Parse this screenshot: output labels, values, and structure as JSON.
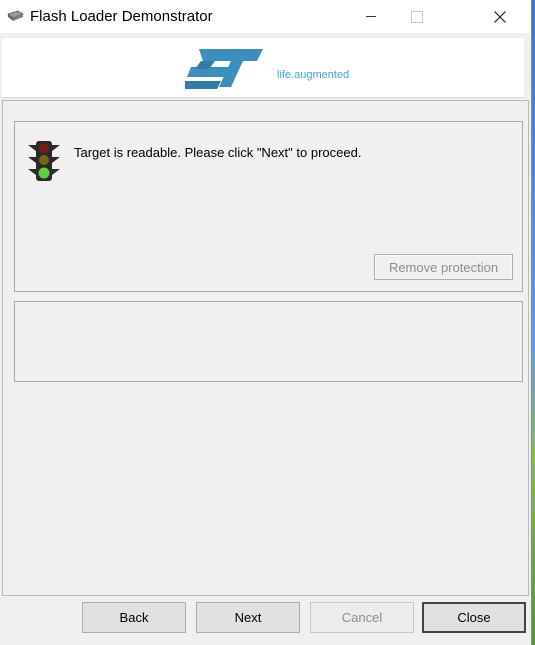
{
  "window": {
    "title": "Flash Loader Demonstrator",
    "app_icon": "chip-icon",
    "controls": {
      "minimize": "minimize-icon",
      "maximize": "maximize-icon",
      "close": "close-icon"
    }
  },
  "header": {
    "logo": "st-logo",
    "tagline": "life.augmented",
    "colors": {
      "logo_blue": "#3a8fbf",
      "tagline": "#39a9dc"
    }
  },
  "status": {
    "icon": "traffic-light-icon",
    "message": "Target is readable. Please click \"Next\" to proceed.",
    "remove_protection_label": "Remove protection"
  },
  "footer": {
    "back_label": "Back",
    "next_label": "Next",
    "cancel_label": "Cancel",
    "close_label": "Close"
  }
}
